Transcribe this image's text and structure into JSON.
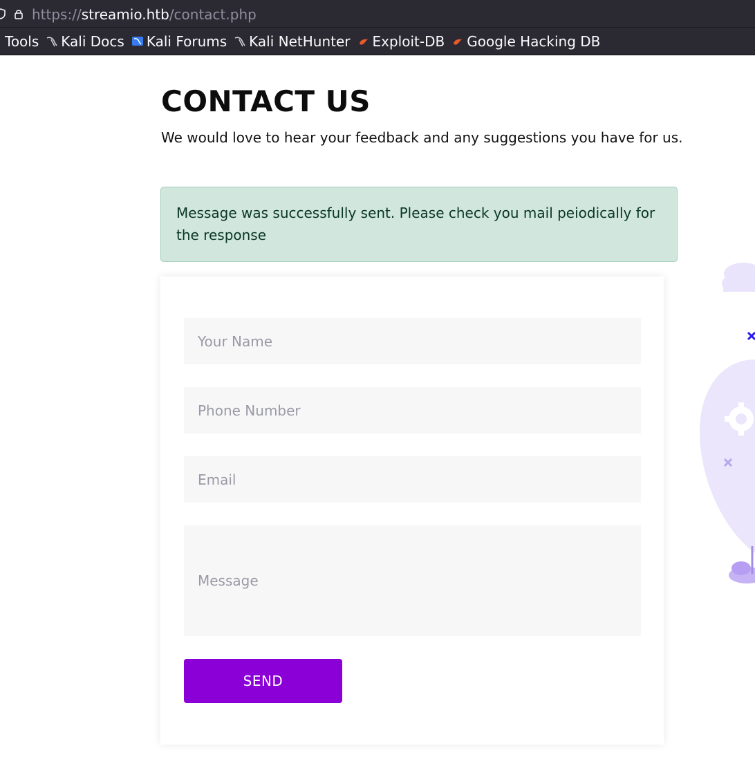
{
  "browser": {
    "url_scheme": "https://",
    "url_host": "streamio.htb",
    "url_path": "/contact.php",
    "bookmarks": [
      {
        "label": "Tools",
        "icon": "none"
      },
      {
        "label": "Kali Docs",
        "icon": "kali-dragon-icon"
      },
      {
        "label": "Kali Forums",
        "icon": "kali-forums-icon"
      },
      {
        "label": "Kali NetHunter",
        "icon": "kali-dragon-icon"
      },
      {
        "label": "Exploit-DB",
        "icon": "exploit-db-icon"
      },
      {
        "label": "Google Hacking DB",
        "icon": "exploit-db-icon"
      }
    ]
  },
  "page": {
    "title": "CONTACT US",
    "subtitle": "We would love to hear your feedback and any suggestions you have for us.",
    "alert_message": "Message was successfully sent. Please check you mail peiodically for the response"
  },
  "form": {
    "name_placeholder": "Your Name",
    "phone_placeholder": "Phone Number",
    "email_placeholder": "Email",
    "message_placeholder": "Message",
    "send_label": "SEND"
  },
  "colors": {
    "send_button": "#8b00d6",
    "alert_bg": "#d1e7dd",
    "alert_text": "#0a3622",
    "illustration": "#e4dcfb"
  }
}
